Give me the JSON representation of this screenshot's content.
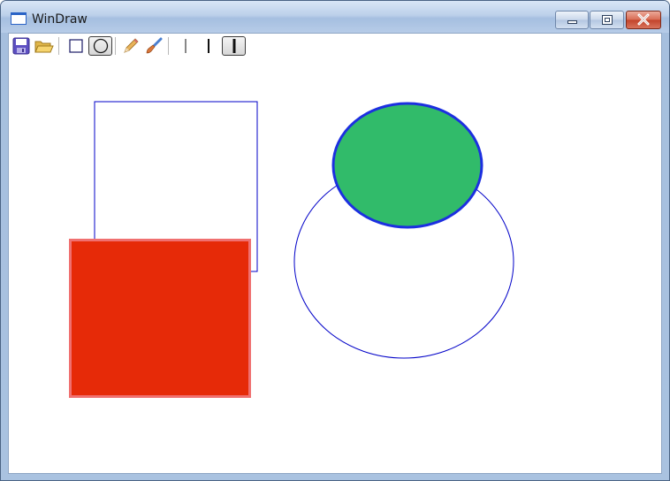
{
  "window": {
    "title": "WinDraw"
  },
  "title_controls": {
    "minimize": "minimize-icon",
    "maximize": "maximize-icon",
    "close": "close-icon"
  },
  "toolbar": {
    "tools": [
      {
        "id": "save",
        "icon": "save-icon"
      },
      {
        "id": "open",
        "icon": "folder-open-icon"
      },
      {
        "id": "rectangle",
        "icon": "rectangle-tool-icon"
      },
      {
        "id": "ellipse",
        "icon": "ellipse-tool-icon",
        "selected": true
      },
      {
        "id": "pencil",
        "icon": "pencil-icon"
      },
      {
        "id": "brush",
        "icon": "brush-icon"
      },
      {
        "id": "thin-line",
        "icon": "line-width-thin-icon"
      },
      {
        "id": "medium-line",
        "icon": "line-width-medium-icon"
      },
      {
        "id": "thick-line",
        "icon": "line-width-thick-icon",
        "selected": true
      }
    ]
  },
  "canvas": {
    "background": "#ffffff",
    "shapes": [
      {
        "type": "rectangle",
        "fill": "none",
        "stroke": "#0000c8"
      },
      {
        "type": "rectangle",
        "fill": "#e62a08",
        "stroke": "#f07070"
      },
      {
        "type": "ellipse",
        "fill": "none",
        "stroke": "#0000c8"
      },
      {
        "type": "ellipse",
        "fill": "#31bb6a",
        "stroke": "#1c2fe0"
      }
    ]
  }
}
